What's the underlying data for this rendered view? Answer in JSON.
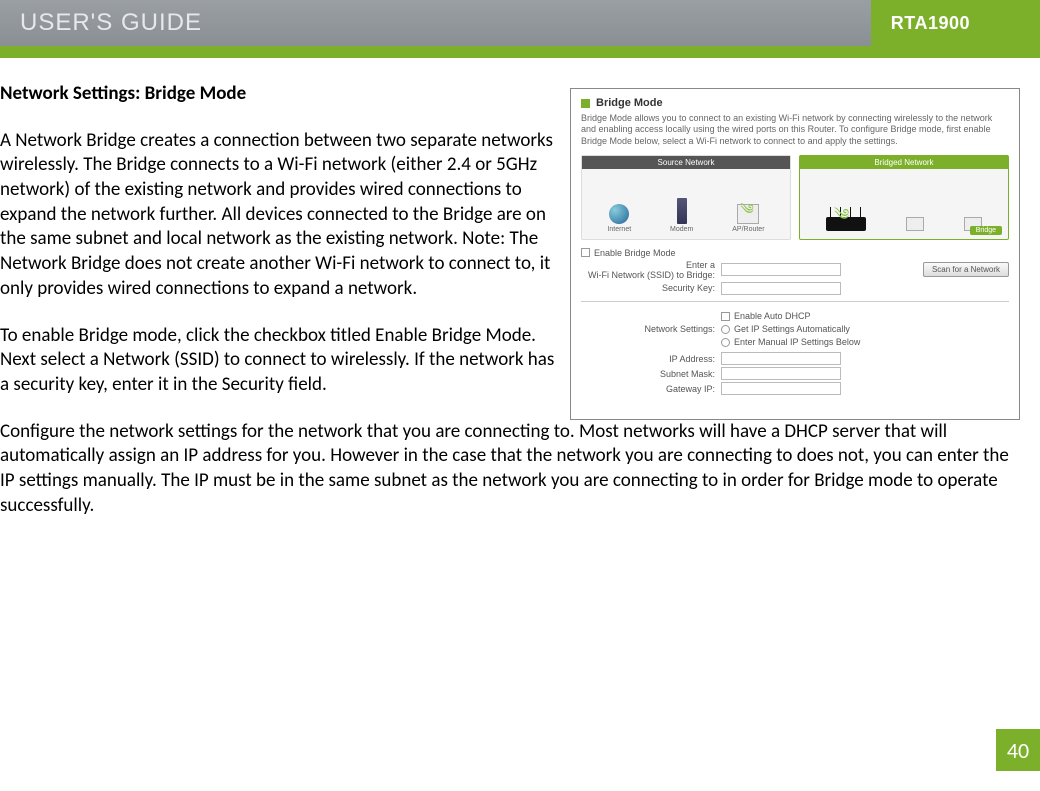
{
  "header": {
    "title": "USER'S GUIDE",
    "model": "RTA1900"
  },
  "section_heading": "Network Settings: Bridge Mode",
  "para1": "A Network Bridge creates a connection between two separate networks wirelessly. The Bridge connects to a Wi-Fi network (either 2.4 or 5GHz network) of the existing network and provides wired connections to expand the network further. All devices connected to the Bridge are on the same subnet and local network as the existing network. Note: The Network Bridge does not create another Wi-Fi network to connect to, it only provides wired connections to expand a network.",
  "para2": "To enable Bridge mode, click the checkbox titled Enable Bridge Mode. Next select a Network (SSID) to connect to wirelessly. If the network has a security key, enter it in the Security field.",
  "para3": "Configure the network settings for the network that you are connecting to. Most networks will have a DHCP server that will automatically assign an IP address for you. However in the case that the network you are connecting to does not, you can enter the IP settings manually. The IP must be in the same subnet as the network you are connecting to in order for Bridge mode to operate successfully.",
  "panel": {
    "title": "Bridge Mode",
    "desc": "Bridge Mode allows you to connect to an existing Wi-Fi network by connecting wirelessly to the network and enabling access locally using the wired ports on this Router. To configure Bridge mode, first enable Bridge Mode below, select a Wi-Fi network to connect to and apply the settings.",
    "src_label": "Source Network",
    "bridged_label": "Bridged Network",
    "icon_internet": "Internet",
    "icon_modem": "Modem",
    "icon_ap": "AP/Router",
    "bridge_badge": "Bridge",
    "enable_label": "Enable Bridge Mode",
    "ssid_label": "Enter a\nWi-Fi Network (SSID) to Bridge:",
    "seckey_label": "Security Key:",
    "scan_btn": "Scan for a Network",
    "ns_label": "Network Settings:",
    "opt_auto_dhcp": "Enable Auto DHCP",
    "opt_get_auto": "Get IP Settings Automatically",
    "opt_manual": "Enter Manual IP Settings Below",
    "ip_label": "IP Address:",
    "subnet_label": "Subnet Mask:",
    "gw_label": "Gateway IP:"
  },
  "page_number": "40"
}
